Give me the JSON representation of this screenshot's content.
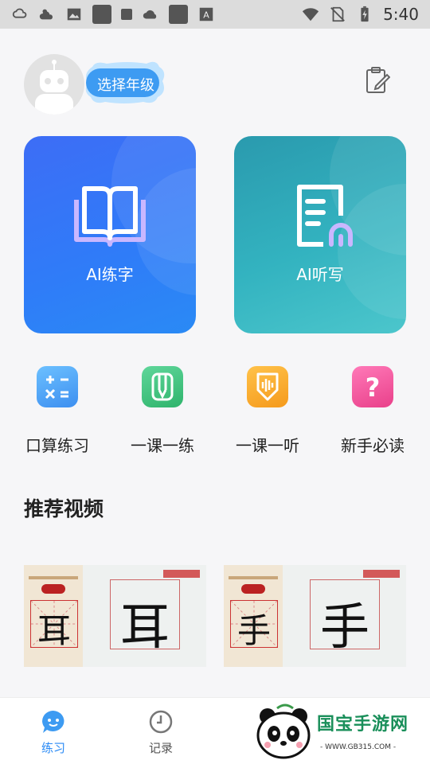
{
  "status_bar": {
    "time": "5:40",
    "icons": [
      "cloud-sun-icon",
      "cloud-sun-icon",
      "image-icon",
      "app-icon",
      "app-icon",
      "cloud-icon",
      "app-icon",
      "font-icon",
      "wifi-icon",
      "no-sim-icon",
      "battery-charging-icon"
    ]
  },
  "header": {
    "grade_label": "选择年级"
  },
  "cards": [
    {
      "label": "AI练字",
      "icon": "book-icon"
    },
    {
      "label": "AI听写",
      "icon": "dictation-icon"
    }
  ],
  "quick_actions": [
    {
      "label": "口算练习",
      "icon": "calculator-icon",
      "color": "#4aa3f0"
    },
    {
      "label": "一课一练",
      "icon": "pencil-icon",
      "color": "#38c07a"
    },
    {
      "label": "一课一听",
      "icon": "audio-icon",
      "color": "#f5a623"
    },
    {
      "label": "新手必读",
      "icon": "question-icon",
      "color": "#ee4f9a"
    }
  ],
  "recommend": {
    "title": "推荐视频",
    "videos": [
      {
        "character": "耳"
      },
      {
        "character": "手"
      }
    ]
  },
  "tabbar": {
    "tabs": [
      {
        "label": "练习",
        "active": true
      },
      {
        "label": "记录",
        "active": false
      }
    ]
  },
  "watermark": {
    "text": "国宝手游网",
    "url": "- WWW.GB315.COM -"
  },
  "colors": {
    "accent": "#2a8af5",
    "card_write": "#3570f6",
    "card_listen": "#33b3c0"
  }
}
